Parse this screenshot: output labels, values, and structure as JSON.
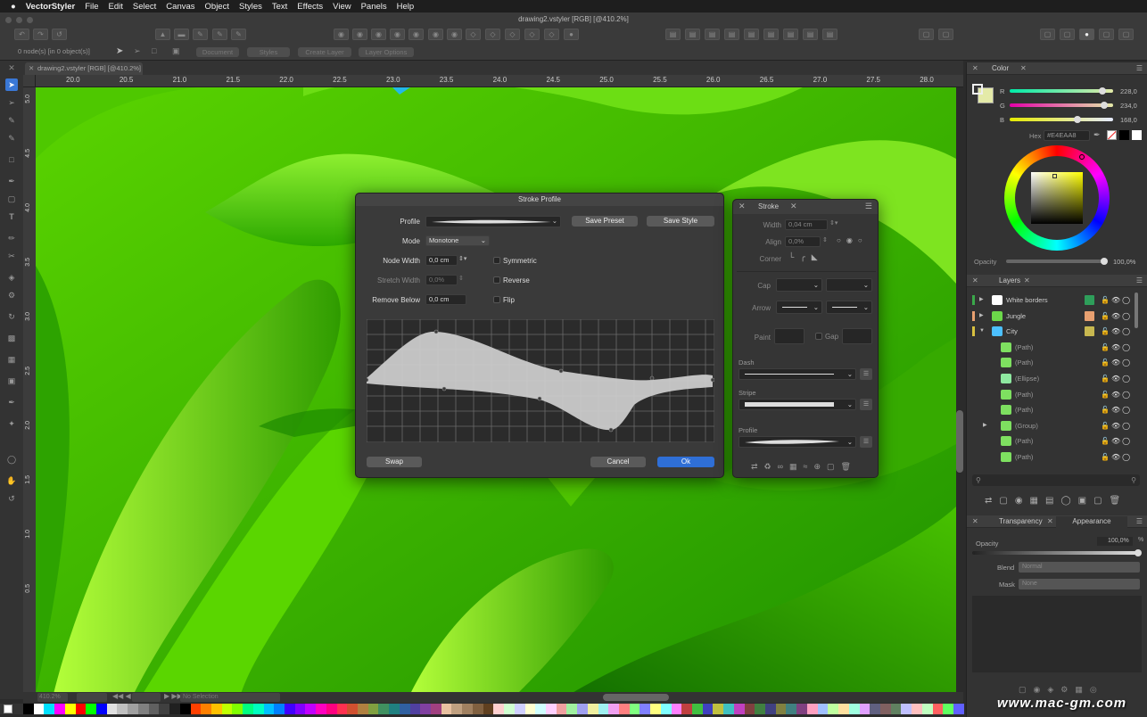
{
  "menubar": {
    "apple": "",
    "app_name": "VectorStyler",
    "items": [
      "File",
      "Edit",
      "Select",
      "Canvas",
      "Object",
      "Styles",
      "Text",
      "Effects",
      "View",
      "Panels",
      "Help"
    ]
  },
  "window": {
    "title": "drawing2.vstyler [RGB] [@410.2%]",
    "status_left": "0 node(s) [in 0 object(s)]",
    "context_buttons": [
      "Document",
      "Styles",
      "Create Layer",
      "Layer Options"
    ],
    "doc_tab": "drawing2.vstyler [RGB] [@410.2%]"
  },
  "ruler": {
    "top_labels": [
      "20.0",
      "20.5",
      "21.0",
      "21.5",
      "22.0",
      "22.5",
      "23.0",
      "23.5",
      "24.0",
      "24.5",
      "25.0",
      "25.5",
      "26.0",
      "26.5",
      "27.0",
      "27.5",
      "28.0"
    ],
    "left_labels": [
      "5.0",
      "4.5",
      "4.0",
      "3.5",
      "3.0",
      "2.5",
      "2.0",
      "1.5",
      "1.0",
      "0.5"
    ]
  },
  "statusbar": {
    "zoom": "410.2%",
    "selection": "No Selection"
  },
  "stroke_profile_dialog": {
    "title": "Stroke Profile",
    "profile_label": "Profile",
    "save_preset": "Save Preset",
    "save_style": "Save Style",
    "mode_label": "Mode",
    "mode_value": "Monotone",
    "node_width_label": "Node Width",
    "node_width_value": "0,0 cm",
    "symmetric_label": "Symmetric",
    "stretch_width_label": "Stretch Width",
    "stretch_width_value": "0,0%",
    "reverse_label": "Reverse",
    "remove_below_label": "Remove Below",
    "remove_below_value": "0,0 cm",
    "flip_label": "Flip",
    "swap": "Swap",
    "cancel": "Cancel",
    "ok": "Ok"
  },
  "stroke_panel": {
    "tab": "Stroke",
    "width_label": "Width",
    "width_value": "0,04 cm",
    "align_label": "Align",
    "align_value": "0,0%",
    "corner_label": "Corner",
    "cap_label": "Cap",
    "arrow_label": "Arrow",
    "paint_label": "Paint",
    "gap_label": "Gap",
    "dash_label": "Dash",
    "stripe_label": "Stripe",
    "profile_label": "Profile"
  },
  "color_panel": {
    "tab": "Color",
    "r_label": "R",
    "r_value": "228,0",
    "r_fraction": 0.894,
    "g_label": "G",
    "g_value": "234,0",
    "g_fraction": 0.918,
    "b_label": "B",
    "b_value": "168,0",
    "b_fraction": 0.659,
    "hex_label": "Hex",
    "hex_value": "#E4EAA8",
    "opacity_label": "Opacity",
    "opacity_value": "100,0%",
    "current_color": "#E4EAA8"
  },
  "layers_panel": {
    "tab": "Layers",
    "rows": [
      {
        "name": "White borders",
        "swatch": "#2e9e5a",
        "bar": "#3aa84a",
        "expander": "▶",
        "thumb": "#ffffff"
      },
      {
        "name": "Jungle",
        "swatch": "#e8a070",
        "bar": "#e8a070",
        "expander": "▶",
        "thumb": "#6cd84a"
      },
      {
        "name": "City",
        "swatch": "#c8b850",
        "bar": "#d8c040",
        "expander": "▼",
        "thumb": "#4cc0ff"
      },
      {
        "name": "(Path)",
        "swatch": "",
        "bar": "",
        "expander": "",
        "thumb": "#7ee060"
      },
      {
        "name": "(Path)",
        "swatch": "",
        "bar": "",
        "expander": "",
        "thumb": "#7ee060"
      },
      {
        "name": "(Ellipse)",
        "swatch": "",
        "bar": "",
        "expander": "",
        "thumb": "#8ee8a0"
      },
      {
        "name": "(Path)",
        "swatch": "",
        "bar": "",
        "expander": "",
        "thumb": "#7ee060"
      },
      {
        "name": "(Path)",
        "swatch": "",
        "bar": "",
        "expander": "",
        "thumb": "#7ee060"
      },
      {
        "name": "(Group)",
        "swatch": "",
        "bar": "",
        "expander": "▶",
        "thumb": "#7ee060"
      },
      {
        "name": "(Path)",
        "swatch": "",
        "bar": "",
        "expander": "",
        "thumb": "#7ee060"
      },
      {
        "name": "(Path)",
        "swatch": "",
        "bar": "",
        "expander": "",
        "thumb": "#7ee060"
      }
    ]
  },
  "transparency_panel": {
    "tab": "Transparency",
    "tab2": "Appearance",
    "opacity_label": "Opacity",
    "opacity_value": "100,0%",
    "percent": "%",
    "blend_label": "Blend",
    "blend_value": "Normal",
    "mask_label": "Mask",
    "mask_value": "None"
  },
  "watermark": "www.mac-gm.com"
}
